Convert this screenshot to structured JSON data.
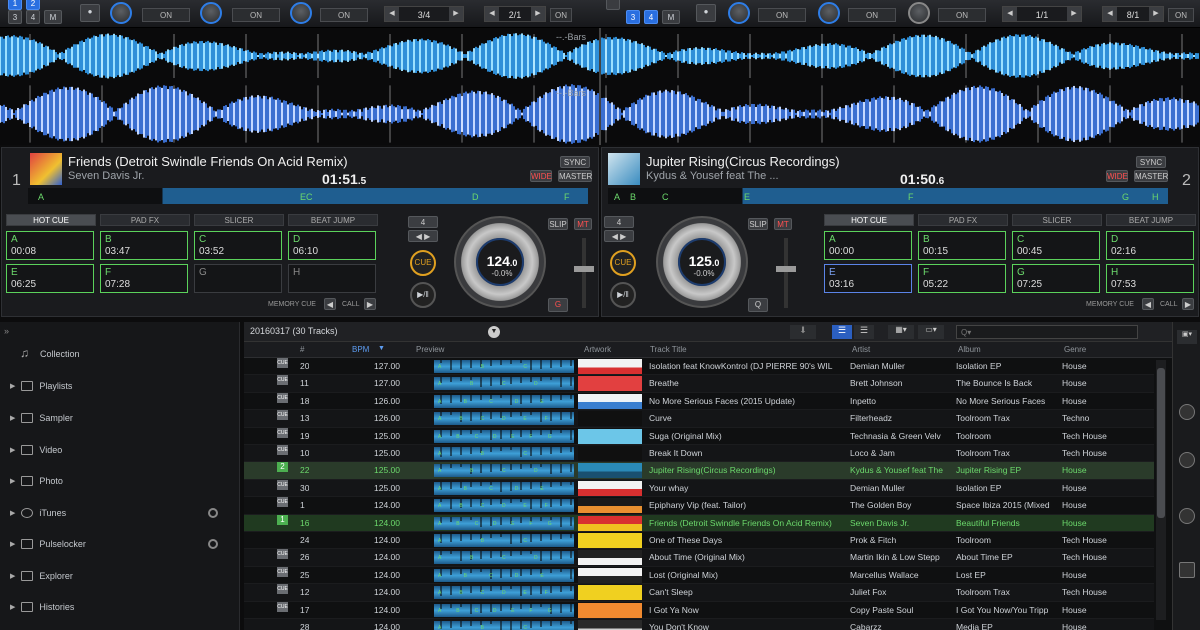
{
  "top": {
    "left_pad_nums": [
      "1",
      "2",
      "3",
      "4",
      "M"
    ],
    "right_pad_nums": [
      "3",
      "4",
      "M"
    ],
    "on_label": "ON",
    "pager_a": "3/4",
    "pager_b": "2/1",
    "pager_c": "1/1",
    "pager_d": "8/1",
    "bars_label": "--.-Bars"
  },
  "deck1": {
    "number": "1",
    "title": "Friends (Detroit Swindle Friends On Acid Remix)",
    "artist": "Seven Davis Jr.",
    "time_main": "01:51",
    "time_frac": ".5",
    "sync": "SYNC",
    "wide": "WIDE",
    "master": "MASTER",
    "bpm_main": "124",
    "bpm_frac": ".0",
    "pitch": "-0.0%",
    "tabs": [
      "HOT CUE",
      "PAD FX",
      "SLICER",
      "BEAT JUMP"
    ],
    "pads": [
      {
        "letter": "A",
        "time": "00:08"
      },
      {
        "letter": "B",
        "time": "03:47"
      },
      {
        "letter": "C",
        "time": "03:52"
      },
      {
        "letter": "D",
        "time": "06:10"
      },
      {
        "letter": "E",
        "time": "06:25"
      },
      {
        "letter": "F",
        "time": "07:28"
      },
      {
        "letter": "G",
        "time": ""
      },
      {
        "letter": "H",
        "time": ""
      }
    ],
    "memory_cue": "MEMORY CUE",
    "call": "CALL",
    "beat": "4",
    "slip": "SLIP",
    "mt": "MT",
    "cue": "CUE",
    "quant": "Q",
    "overview_letters": [
      "A",
      "EC",
      "D",
      "F"
    ]
  },
  "deck2": {
    "number": "2",
    "title": "Jupiter Rising(Circus Recordings)",
    "artist": "Kydus & Yousef feat The ...",
    "time_main": "01:50",
    "time_frac": ".6",
    "sync": "SYNC",
    "wide": "WIDE",
    "master": "MASTER",
    "bpm_main": "125",
    "bpm_frac": ".0",
    "pitch": "-0.0%",
    "tabs": [
      "HOT CUE",
      "PAD FX",
      "SLICER",
      "BEAT JUMP"
    ],
    "pads": [
      {
        "letter": "A",
        "time": "00:00"
      },
      {
        "letter": "B",
        "time": "00:15"
      },
      {
        "letter": "C",
        "time": "00:45"
      },
      {
        "letter": "D",
        "time": "02:16"
      },
      {
        "letter": "E",
        "time": "03:16"
      },
      {
        "letter": "F",
        "time": "05:22"
      },
      {
        "letter": "G",
        "time": "07:25"
      },
      {
        "letter": "H",
        "time": "07:53"
      }
    ],
    "memory_cue": "MEMORY CUE",
    "call": "CALL",
    "beat": "4",
    "slip": "SLIP",
    "mt": "MT",
    "cue": "CUE",
    "quant": "Q",
    "overview_letters": [
      "A",
      "B",
      "C",
      "E",
      "F",
      "G",
      "H"
    ]
  },
  "sidebar": {
    "items": [
      "Collection",
      "Playlists",
      "Sampler",
      "Video",
      "Photo",
      "iTunes",
      "Pulselocker",
      "Explorer",
      "Histories"
    ]
  },
  "browser": {
    "title": "20160317 (30 Tracks)",
    "columns": [
      "#",
      "BPM",
      "Preview",
      "Artwork",
      "Track Title",
      "Artist",
      "Album",
      "Genre"
    ],
    "search_placeholder": "Q▾",
    "rows": [
      {
        "cue": "CUE",
        "num": "20",
        "bpm": "127.00",
        "title": "Isolation feat KnowKontrol (DJ PIERRE 90's WIL",
        "artist": "Demian Muller",
        "album": "Isolation EP",
        "genre": "House",
        "art": "#f2f2f2",
        "art2": "#d83030"
      },
      {
        "cue": "CUE",
        "num": "11",
        "bpm": "127.00",
        "title": "Breathe",
        "artist": "Brett Johnson",
        "album": "The Bounce Is Back",
        "genre": "House",
        "art": "#e24040",
        "art2": "#e24040"
      },
      {
        "cue": "CUE",
        "num": "18",
        "bpm": "126.00",
        "title": "No More Serious Faces (2015 Update)",
        "artist": "Inpetto",
        "album": "No More Serious Faces",
        "genre": "House",
        "art": "#eef3f7",
        "art2": "#3a7fd0"
      },
      {
        "cue": "CUE",
        "num": "13",
        "bpm": "126.00",
        "title": "Curve",
        "artist": "Filterheadz",
        "album": "Toolroom Trax",
        "genre": "Techno",
        "art": "#101010",
        "art2": "#101010"
      },
      {
        "cue": "CUE",
        "num": "19",
        "bpm": "125.00",
        "title": "Suga (Original Mix)",
        "artist": "Technasia & Green Velv",
        "album": "Toolroom",
        "genre": "Tech House",
        "art": "#6cc6e8",
        "art2": "#6cc6e8"
      },
      {
        "cue": "CUE",
        "num": "10",
        "bpm": "125.00",
        "title": "Break It Down",
        "artist": "Loco & Jam",
        "album": "Toolroom Trax",
        "genre": "Tech House",
        "art": "#101010",
        "art2": "#101010"
      },
      {
        "cue": "2",
        "num": "22",
        "bpm": "125.00",
        "title": "Jupiter Rising(Circus Recordings)",
        "artist": "Kydus & Yousef feat The",
        "album": "Jupiter Rising EP",
        "genre": "House",
        "art": "#2a8ab8",
        "art2": "#1a5070",
        "hl": "deck2"
      },
      {
        "cue": "CUE",
        "num": "30",
        "bpm": "125.00",
        "title": "Your whay",
        "artist": "Demian Muller",
        "album": "Isolation EP",
        "genre": "House",
        "art": "#f2f2f2",
        "art2": "#d83030"
      },
      {
        "cue": "CUE",
        "num": "1",
        "bpm": "124.00",
        "title": "Epiphany Vip (feat. Tailor)",
        "artist": "The Golden Boy",
        "album": "Space Ibiza 2015 (Mixed",
        "genre": "House",
        "art": "#1a1a1a",
        "art2": "#e89030"
      },
      {
        "cue": "1",
        "num": "16",
        "bpm": "124.00",
        "title": "Friends (Detroit Swindle Friends On Acid Remix)",
        "artist": "Seven Davis Jr.",
        "album": "Beautiful Friends",
        "genre": "House",
        "art": "#d83030",
        "art2": "#f0c020",
        "hl": "deck1"
      },
      {
        "cue": "",
        "num": "24",
        "bpm": "124.00",
        "title": "One of These Days",
        "artist": "Prok & Fitch",
        "album": "Toolroom",
        "genre": "Tech House",
        "art": "#f0d020",
        "art2": "#f0d020"
      },
      {
        "cue": "CUE",
        "num": "26",
        "bpm": "124.00",
        "title": "About Time (Original Mix)",
        "artist": "Martin Ikin & Low Stepp",
        "album": "About Time EP",
        "genre": "Tech House",
        "art": "#222222",
        "art2": "#f2f2f2"
      },
      {
        "cue": "CUE",
        "num": "25",
        "bpm": "124.00",
        "title": "Lost (Original Mix)",
        "artist": "Marcellus Wallace",
        "album": "Lost EP",
        "genre": "House",
        "art": "#f2f2f2",
        "art2": "#222222"
      },
      {
        "cue": "CUE",
        "num": "12",
        "bpm": "124.00",
        "title": "Can't Sleep",
        "artist": "Juliet Fox",
        "album": "Toolroom Trax",
        "genre": "Tech House",
        "art": "#f0d020",
        "art2": "#f0d020"
      },
      {
        "cue": "CUE",
        "num": "17",
        "bpm": "124.00",
        "title": "I Got Ya Now",
        "artist": "Copy Paste Soul",
        "album": "I Got You Now/You Tripp",
        "genre": "House",
        "art": "#f08a30",
        "art2": "#f08a30"
      },
      {
        "cue": "",
        "num": "28",
        "bpm": "124.00",
        "title": "You Don't Know",
        "artist": "Cabarzz",
        "album": "Media EP",
        "genre": "House",
        "art": "#2a2a2a",
        "art2": "#d0d0d0"
      }
    ]
  }
}
